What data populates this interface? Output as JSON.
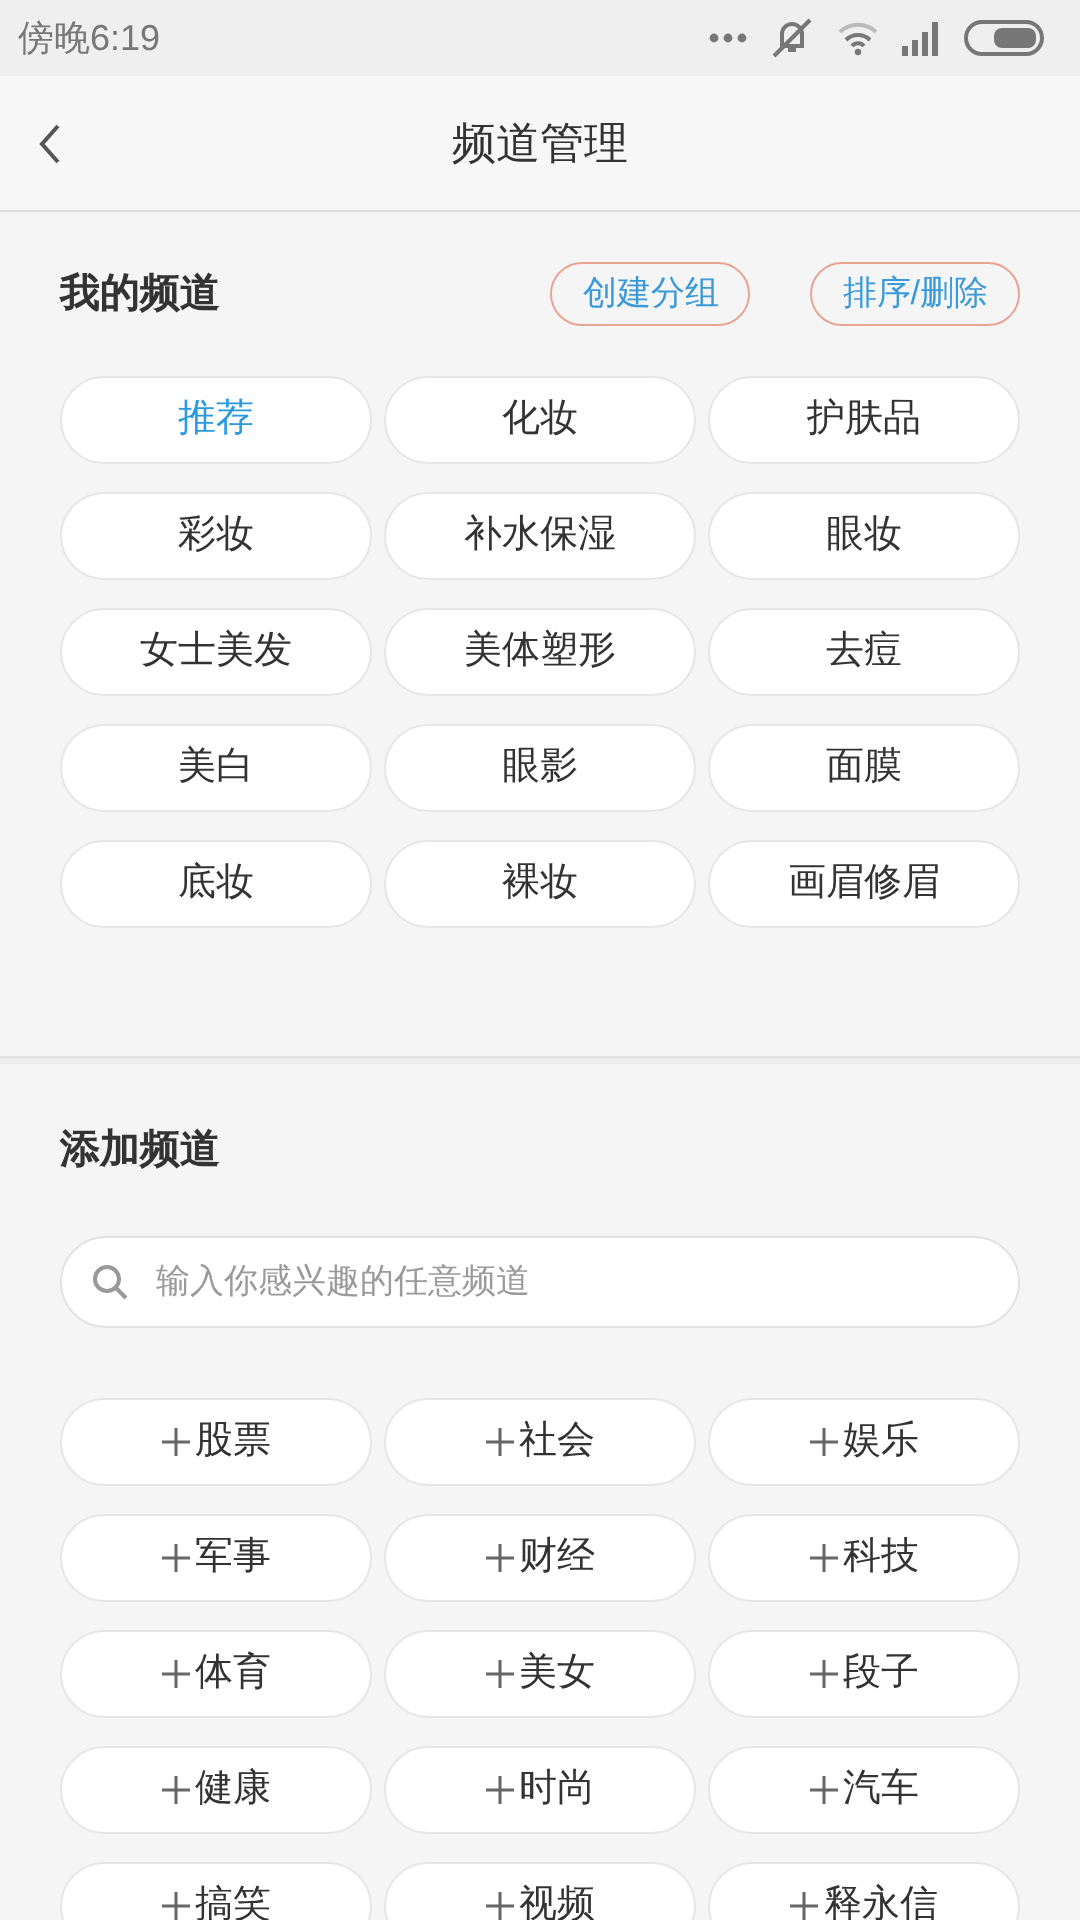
{
  "status_bar": {
    "time": "傍晚6:19"
  },
  "header": {
    "title": "频道管理"
  },
  "my_channels": {
    "title": "我的频道",
    "buttons": [
      "创建分组",
      "排序/删除"
    ],
    "items": [
      {
        "label": "推荐",
        "selected": true
      },
      {
        "label": "化妆",
        "selected": false
      },
      {
        "label": "护肤品",
        "selected": false
      },
      {
        "label": "彩妆",
        "selected": false
      },
      {
        "label": "补水保湿",
        "selected": false
      },
      {
        "label": "眼妆",
        "selected": false
      },
      {
        "label": "女士美发",
        "selected": false
      },
      {
        "label": "美体塑形",
        "selected": false
      },
      {
        "label": "去痘",
        "selected": false
      },
      {
        "label": "美白",
        "selected": false
      },
      {
        "label": "眼影",
        "selected": false
      },
      {
        "label": "面膜",
        "selected": false
      },
      {
        "label": "底妆",
        "selected": false
      },
      {
        "label": "裸妆",
        "selected": false
      },
      {
        "label": "画眉修眉",
        "selected": false
      }
    ]
  },
  "add_channels": {
    "title": "添加频道",
    "search": {
      "placeholder": "输入你感兴趣的任意频道"
    },
    "items": [
      "股票",
      "社会",
      "娱乐",
      "军事",
      "财经",
      "科技",
      "体育",
      "美女",
      "段子",
      "健康",
      "时尚",
      "汽车",
      "搞笑",
      "视频",
      "释永信"
    ]
  }
}
